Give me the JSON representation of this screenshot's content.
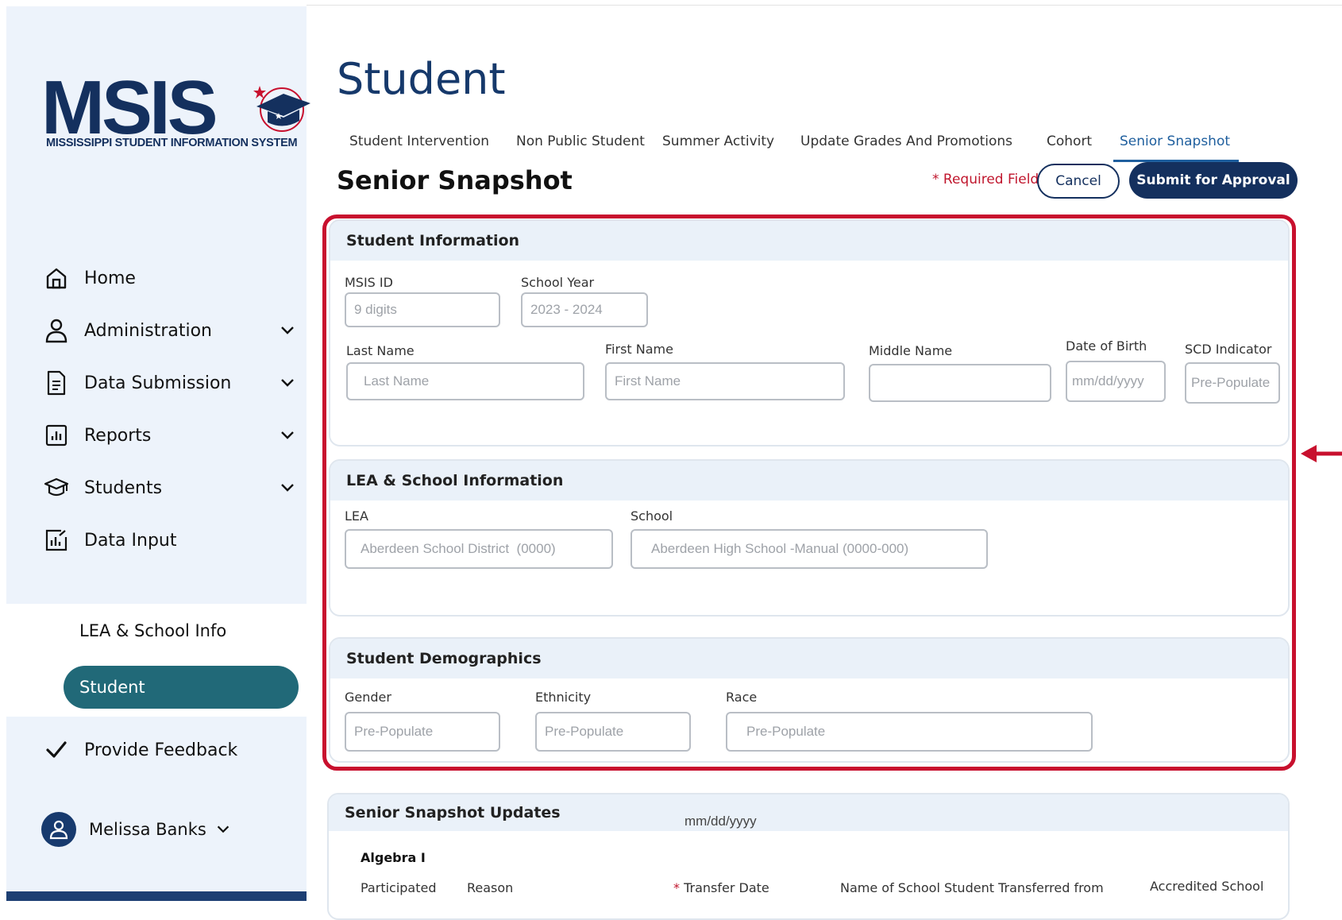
{
  "sidebar": {
    "logo_text": "MSIS",
    "logo_subtitle": "MISSISSIPPI STUDENT INFORMATION SYSTEM",
    "nav": [
      {
        "label": "Home"
      },
      {
        "label": "Administration"
      },
      {
        "label": "Data Submission"
      },
      {
        "label": "Reports"
      },
      {
        "label": "Students"
      },
      {
        "label": "Data Input"
      }
    ],
    "sub_items": [
      {
        "label": "LEA & School Info"
      },
      {
        "label": "Student"
      }
    ],
    "feedback": "Provide Feedback",
    "user": "Melissa Banks"
  },
  "header": {
    "title": "Student",
    "tabs": [
      {
        "label": "Student Intervention"
      },
      {
        "label": "Non Public Student"
      },
      {
        "label": "Summer Activity"
      },
      {
        "label": "Update Grades And Promotions"
      },
      {
        "label": "Cohort"
      },
      {
        "label": "Senior Snapshot"
      }
    ],
    "section_title": "Senior Snapshot",
    "required_note": "* Required Field",
    "cancel": "Cancel",
    "submit": "Submit for Approval"
  },
  "student_info": {
    "title": "Student Information",
    "msis_id": {
      "label": "MSIS ID",
      "placeholder": "9 digits"
    },
    "school_year": {
      "label": "School Year",
      "placeholder": "2023 - 2024"
    },
    "last_name": {
      "label": "Last Name",
      "placeholder": "Last Name"
    },
    "first_name": {
      "label": "First Name",
      "placeholder": "First Name"
    },
    "middle_name": {
      "label": "Middle Name",
      "placeholder": ""
    },
    "dob": {
      "label": "Date of Birth",
      "placeholder": "mm/dd/yyyy"
    },
    "scd": {
      "label": "SCD Indicator",
      "placeholder": "Pre-Populate"
    }
  },
  "lea_info": {
    "title": "LEA & School Information",
    "lea": {
      "label": "LEA",
      "placeholder": "Aberdeen School District  (0000)"
    },
    "school": {
      "label": "School",
      "placeholder": "Aberdeen High School -Manual (0000-000)"
    }
  },
  "demographics": {
    "title": "Student Demographics",
    "gender": {
      "label": "Gender",
      "placeholder": "Pre-Populate"
    },
    "ethnicity": {
      "label": "Ethnicity",
      "placeholder": "Pre-Populate"
    },
    "race": {
      "label": "Race",
      "placeholder": "Pre-Populate"
    }
  },
  "updates": {
    "title": "Senior Snapshot Updates",
    "date_hint": "mm/dd/yyyy",
    "subject": "Algebra I",
    "columns": {
      "participated": "Participated",
      "reason": "Reason",
      "transfer_date": "Transfer Date",
      "transferred_from": "Name of School Student Transferred from",
      "accredited": "Accredited School"
    }
  },
  "colors": {
    "brand_navy": "#14305e",
    "active_teal": "#216978",
    "highlight_red": "#c8102e",
    "tab_active": "#1f5f9e"
  }
}
